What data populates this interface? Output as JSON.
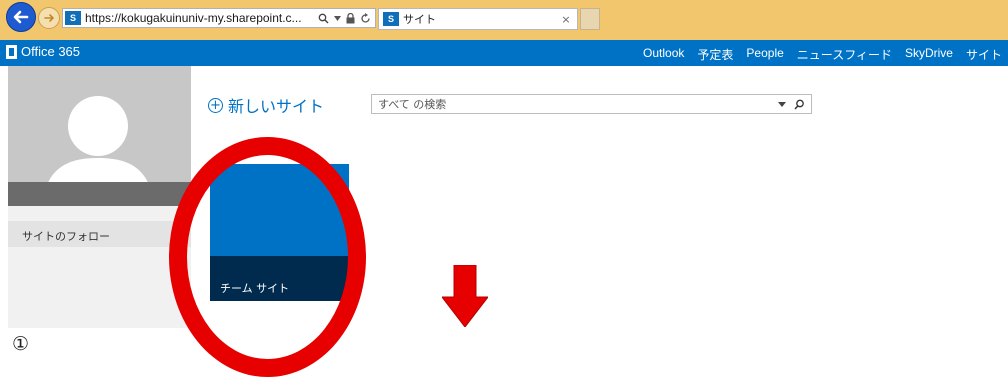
{
  "browser": {
    "url": "https://kokugakuinuniv-my.sharepoint.c...",
    "favicon_text": "S",
    "tab_title": "サイト",
    "tab_close": "×"
  },
  "o365": {
    "brand": "Office 365",
    "nav": [
      "Outlook",
      "予定表",
      "People",
      "ニュースフィード",
      "SkyDrive",
      "サイト"
    ]
  },
  "left": {
    "follow_label": "サイトのフォロー"
  },
  "main": {
    "new_site_label": "新しいサイト",
    "search_placeholder": "すべて の検索",
    "tile_label": "チーム サイト"
  },
  "annotation": {
    "caption": "①",
    "circle_color": "#e60000",
    "arrow_color": "#e60000"
  },
  "colors": {
    "o365_blue": "#0072c6",
    "tile_dark": "#002a4e",
    "browser_bar": "#f2c66d"
  },
  "icons": [
    "back-arrow-icon",
    "forward-arrow-icon",
    "sharepoint-favicon-icon",
    "search-icon",
    "lock-icon",
    "refresh-icon",
    "plus-circle-icon",
    "dropdown-icon",
    "office-logo-icon"
  ]
}
